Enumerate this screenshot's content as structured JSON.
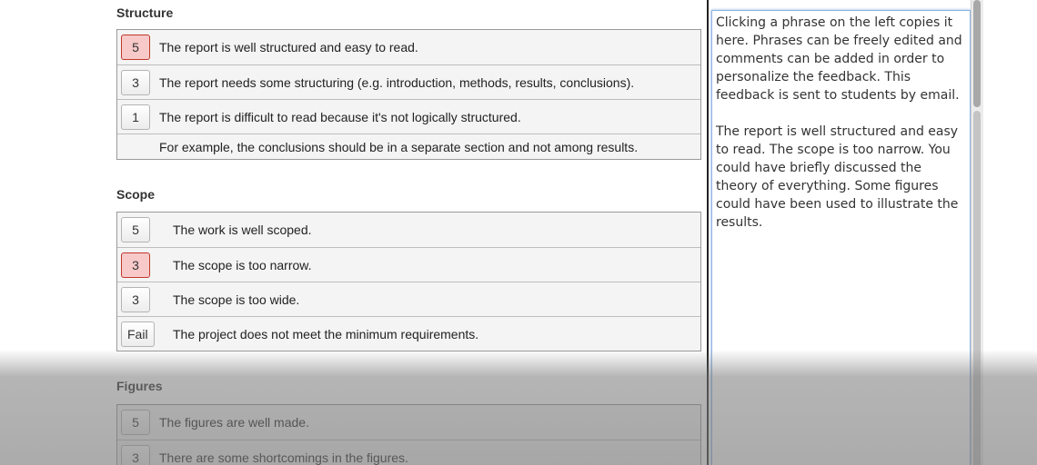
{
  "sections": [
    {
      "title": "Structure",
      "rows": [
        {
          "score": "5",
          "text": "The report is well structured and easy to read.",
          "selected": true
        },
        {
          "score": "3",
          "text": "The report needs some structuring (e.g. introduction, methods, results, conclusions).",
          "selected": false
        },
        {
          "score": "1",
          "text": "The report is difficult to read because it's not logically structured.",
          "selected": false
        },
        {
          "score": "",
          "text": "For example, the conclusions should be in a separate section and not among results.",
          "selected": false
        }
      ]
    },
    {
      "title": "Scope",
      "rows": [
        {
          "score": "5",
          "text": "The work is well scoped.",
          "selected": false
        },
        {
          "score": "3",
          "text": "The scope is too narrow.",
          "selected": true
        },
        {
          "score": "3",
          "text": "The scope is too wide.",
          "selected": false
        },
        {
          "score": "Fail",
          "text": "The project does not meet the minimum requirements.",
          "selected": false
        }
      ]
    },
    {
      "title": "Figures",
      "rows": [
        {
          "score": "5",
          "text": "The figures are well made.",
          "selected": false
        },
        {
          "score": "3",
          "text": "There are some shortcomings in the figures.",
          "selected": false
        }
      ]
    }
  ],
  "feedback": {
    "text": "Clicking a phrase on the left copies it here. Phrases can be freely edited and comments can be added in order to personalize the feedback. This feedback is sent to students by email.\n\nThe report is well structured and easy to read. The scope is too narrow. You could have briefly discussed the theory of everything. Some figures could have been used to illustrate the results."
  },
  "colors": {
    "selected": "#f8c9c9",
    "focus_border": "#8db3e2"
  }
}
